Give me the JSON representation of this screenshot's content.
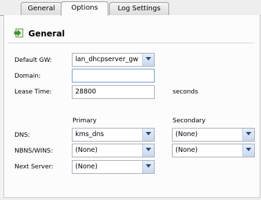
{
  "tabs": [
    {
      "label": "General"
    },
    {
      "label": "Options"
    },
    {
      "label": "Log Settings"
    }
  ],
  "section": {
    "title": "General",
    "icon": "arrow-into-box-icon"
  },
  "fields": {
    "default_gw": {
      "label": "Default GW:",
      "value": "lan_dhcpserver_gw"
    },
    "domain": {
      "label": "Domain:",
      "value": ""
    },
    "lease_time": {
      "label": "Lease Time:",
      "value": "28800",
      "unit": "seconds"
    }
  },
  "columns": {
    "primary": "Primary",
    "secondary": "Secondary"
  },
  "rows": {
    "dns": {
      "label": "DNS:",
      "primary": "kms_dns",
      "secondary": "(None)"
    },
    "nbns": {
      "label": "NBNS/WINS:",
      "primary": "(None)",
      "secondary": "(None)"
    },
    "next_server": {
      "label": "Next Server:",
      "primary": "(None)"
    }
  }
}
